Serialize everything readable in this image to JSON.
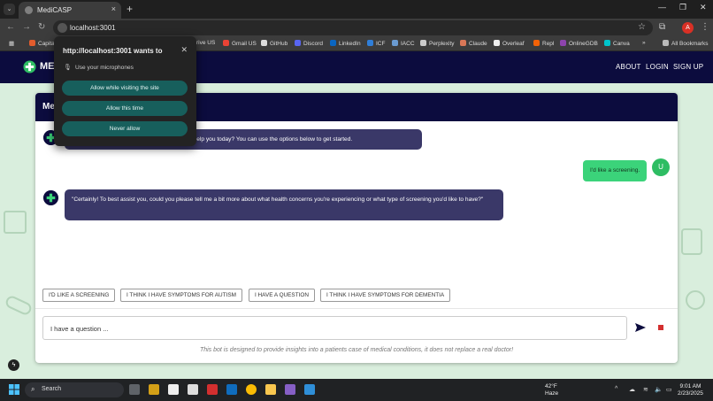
{
  "browser": {
    "tab_title": "MediCASP",
    "url": "localhost:3001",
    "all_bookmarks": "All Bookmarks",
    "bookmarks": [
      "Capita",
      "rive US",
      "Gmail US",
      "GitHub",
      "Discord",
      "LinkedIn",
      "ICF",
      "IACC",
      "Perplexity",
      "Claude",
      "Overleaf",
      "Repl",
      "OnlineGDB",
      "Canva"
    ],
    "profile_initial": "A"
  },
  "site": {
    "logo_text": "MEDI",
    "nav": {
      "about": "ABOUT",
      "login": "LOGIN",
      "signup": "SIGN UP"
    },
    "chat_title": "Me"
  },
  "chat": {
    "messages": [
      {
        "from": "bot",
        "text": "istant. How can I help you today? You can use the options below to get started."
      },
      {
        "from": "user",
        "text": "I'd like a screening.",
        "avatar": "U"
      },
      {
        "from": "bot",
        "text": "\"Certainly! To best assist you, could you please tell me a bit more about what health concerns you're experiencing or what type of screening you'd like to have?\""
      }
    ],
    "options": [
      "I'D LIKE A SCREENING",
      "I THINK I HAVE SYMPTOMS FOR AUTISM",
      "I HAVE A QUESTION",
      "I THINK I HAVE SYMPTOMS FOR DEMENTIA"
    ],
    "input_value": "I have a question ...",
    "disclaimer": "This bot is designed to provide insights into a patients case of medical conditions, it does not replace a real doctor!"
  },
  "permission": {
    "title": "http://localhost:3001 wants to",
    "item": "Use your microphones",
    "buttons": [
      "Allow while visiting the site",
      "Allow this time",
      "Never allow"
    ]
  },
  "taskbar": {
    "search": "Search",
    "weather_temp": "42°F",
    "weather_desc": "Haze",
    "time": "9:01 AM",
    "date": "2/23/2025"
  },
  "colors": {
    "navy": "#0c0c3e",
    "bot_bubble": "#3a3868",
    "user_bubble": "#3bd37a",
    "permission_button": "#175f5c"
  }
}
